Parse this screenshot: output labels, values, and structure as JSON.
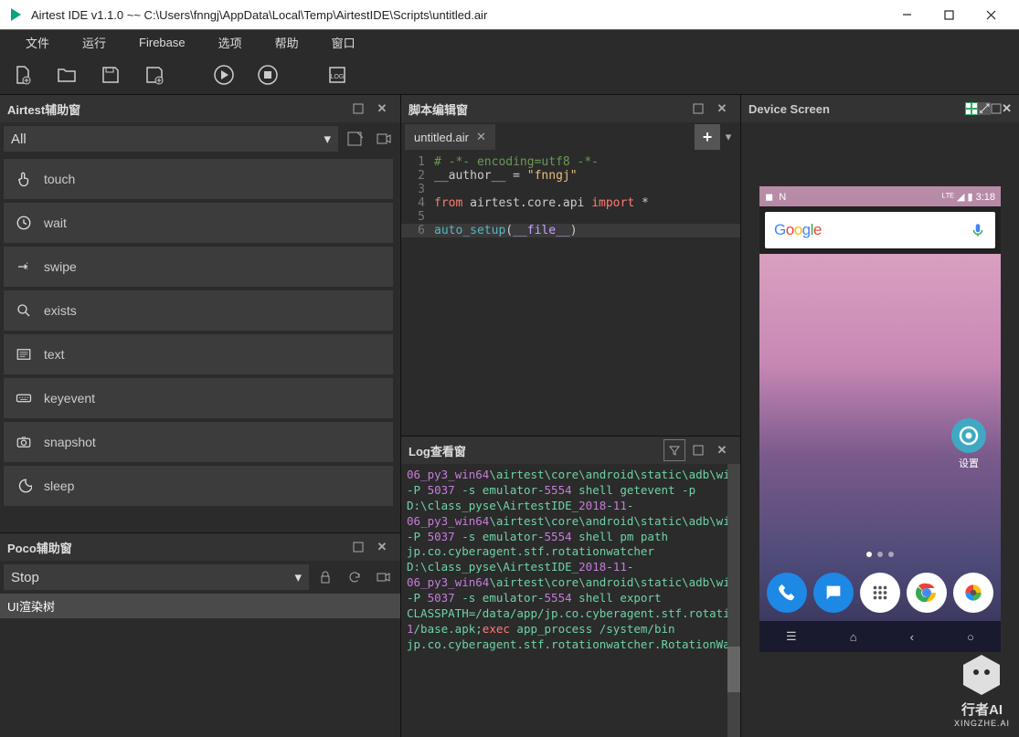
{
  "window": {
    "title": "Airtest IDE v1.1.0 ~~ C:\\Users\\fnngj\\AppData\\Local\\Temp\\AirtestIDE\\Scripts\\untitled.air"
  },
  "menu": [
    "文件",
    "运行",
    "Firebase",
    "选项",
    "帮助",
    "窗口"
  ],
  "panels": {
    "airtest_aux": {
      "title": "Airtest辅助窗",
      "filter": "All"
    },
    "poco_aux": {
      "title": "Poco辅助窗",
      "select": "Stop",
      "tree_label": "UI渲染树"
    },
    "script_editor": {
      "title": "脚本编辑窗",
      "tab": "untitled.air"
    },
    "log_viewer": {
      "title": "Log查看窗"
    },
    "device_screen": {
      "title": "Device Screen"
    }
  },
  "actions": [
    {
      "icon": "touch",
      "label": "touch"
    },
    {
      "icon": "wait",
      "label": "wait"
    },
    {
      "icon": "swipe",
      "label": "swipe"
    },
    {
      "icon": "exists",
      "label": "exists"
    },
    {
      "icon": "text",
      "label": "text"
    },
    {
      "icon": "keyevent",
      "label": "keyevent"
    },
    {
      "icon": "snapshot",
      "label": "snapshot"
    },
    {
      "icon": "sleep",
      "label": "sleep"
    }
  ],
  "code": {
    "lines": [
      {
        "n": 1,
        "segs": [
          {
            "t": "# -*- encoding=utf8 -*-",
            "c": "c-comment"
          }
        ]
      },
      {
        "n": 2,
        "segs": [
          {
            "t": "__author__",
            "c": ""
          },
          {
            "t": " = ",
            "c": ""
          },
          {
            "t": "\"fnngj\"",
            "c": "c-str"
          }
        ]
      },
      {
        "n": 3,
        "segs": [
          {
            "t": "",
            "c": ""
          }
        ]
      },
      {
        "n": 4,
        "segs": [
          {
            "t": "from",
            "c": "c-kw"
          },
          {
            "t": " airtest.core.api ",
            "c": ""
          },
          {
            "t": "import",
            "c": "c-kw"
          },
          {
            "t": " *",
            "c": ""
          }
        ]
      },
      {
        "n": 5,
        "segs": [
          {
            "t": "",
            "c": ""
          }
        ]
      },
      {
        "n": 6,
        "current": true,
        "segs": [
          {
            "t": "auto_setup",
            "c": "c-fn"
          },
          {
            "t": "(",
            "c": ""
          },
          {
            "t": "__file__",
            "c": "c-ident"
          },
          {
            "t": ")",
            "c": ""
          }
        ]
      }
    ]
  },
  "log": [
    [
      {
        "t": "06",
        "c": "num"
      },
      {
        "t": "_py3_win64",
        "c": "path"
      },
      {
        "t": "\\airtest\\core\\android\\static\\adb\\windows\\adb.exe -P ",
        "c": "norm"
      },
      {
        "t": "5037",
        "c": "num"
      },
      {
        "t": " -s emulator-",
        "c": "norm"
      },
      {
        "t": "5554",
        "c": "num"
      },
      {
        "t": " shell getevent -p",
        "c": "norm"
      }
    ],
    [
      {
        "t": "D:\\class_pyse\\AirtestIDE_",
        "c": "norm"
      },
      {
        "t": "2018",
        "c": "num"
      },
      {
        "t": "-",
        "c": "norm"
      },
      {
        "t": "11",
        "c": "num"
      },
      {
        "t": "-",
        "c": "norm"
      },
      {
        "t": "06",
        "c": "num"
      },
      {
        "t": "_py3_win64",
        "c": "path"
      },
      {
        "t": "\\airtest\\core\\android\\static\\adb\\windows\\adb.exe -P ",
        "c": "norm"
      },
      {
        "t": "5037",
        "c": "num"
      },
      {
        "t": " -s emulator-",
        "c": "norm"
      },
      {
        "t": "5554",
        "c": "num"
      },
      {
        "t": " shell pm path jp.co.cyberagent.stf.rotationwatcher",
        "c": "norm"
      }
    ],
    [
      {
        "t": "D:\\class_pyse\\AirtestIDE_",
        "c": "norm"
      },
      {
        "t": "2018",
        "c": "num"
      },
      {
        "t": "-",
        "c": "norm"
      },
      {
        "t": "11",
        "c": "num"
      },
      {
        "t": "-",
        "c": "norm"
      },
      {
        "t": "06",
        "c": "num"
      },
      {
        "t": "_py3_win64",
        "c": "path"
      },
      {
        "t": "\\airtest\\core\\android\\static\\adb\\windows\\adb.exe -P ",
        "c": "norm"
      },
      {
        "t": "5037",
        "c": "num"
      },
      {
        "t": " -s emulator-",
        "c": "norm"
      },
      {
        "t": "5554",
        "c": "num"
      },
      {
        "t": " shell export",
        "c": "norm"
      }
    ],
    [
      {
        "t": "CLASSPATH=/data/app/jp.co.cyberagent.stf.rotationwatcher-",
        "c": "norm"
      },
      {
        "t": "1",
        "c": "num"
      },
      {
        "t": "/base.apk;",
        "c": "norm"
      },
      {
        "t": "exec",
        "c": "exec"
      },
      {
        "t": " app_process /system/bin jp.co.cyberagent.stf.rotationwatcher.RotationWatcher",
        "c": "norm"
      }
    ]
  ],
  "device": {
    "time": "3:18",
    "search_label": "Google",
    "settings_label": "设置"
  },
  "watermark": {
    "brand": "行者AI",
    "domain": "XINGZHE.AI"
  }
}
